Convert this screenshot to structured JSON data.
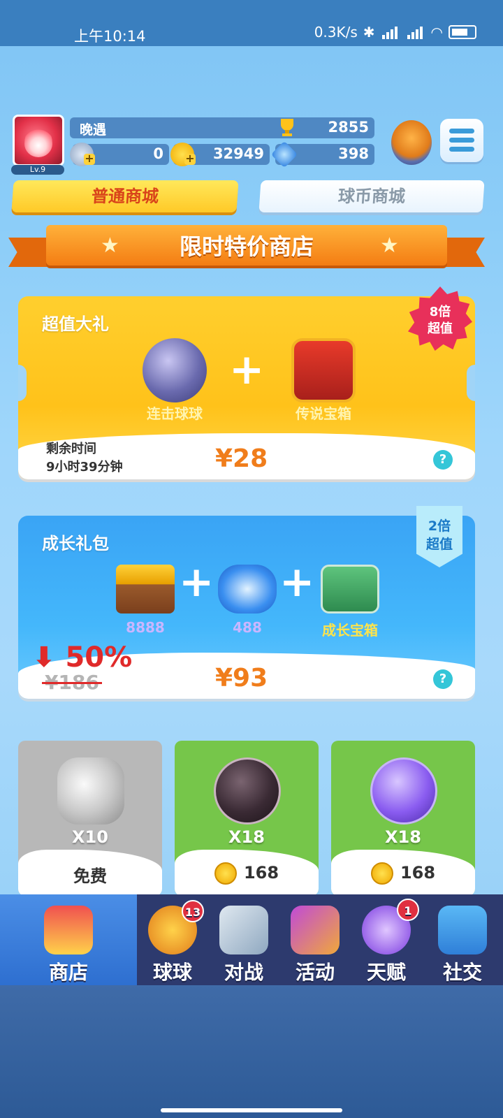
{
  "status": {
    "time": "上午10:14",
    "net": "0.3K/s"
  },
  "player": {
    "name": "晚遇",
    "level": "Lv.9",
    "trophies": "2855",
    "stars": "0",
    "coins": "32949",
    "diamonds": "398"
  },
  "tabs": {
    "normal": "普通商城",
    "ballcoin": "球币商城"
  },
  "banner": {
    "title": "限时特价商店"
  },
  "deal1": {
    "title": "超值大礼",
    "item1": "连击球球",
    "item2": "传说宝箱",
    "remain_label": "剩余时间",
    "remain_time": "9小时39分钟",
    "price": "¥28",
    "badge_top": "8倍",
    "badge_bottom": "超值",
    "help": "?"
  },
  "deal2": {
    "title": "成长礼包",
    "item1": "8888",
    "item2": "488",
    "item3": "成长宝箱",
    "discount": "50%",
    "old_price": "¥186",
    "price": "¥93",
    "badge_top": "2倍",
    "badge_bottom": "超值",
    "help": "?"
  },
  "tiles": [
    {
      "qty": "X10",
      "cost": "免费",
      "color": "#b8b8b8"
    },
    {
      "qty": "X18",
      "cost": "168",
      "color": "#76c64a"
    },
    {
      "qty": "X18",
      "cost": "168",
      "color": "#76c64a"
    }
  ],
  "nav": [
    {
      "label": "商店"
    },
    {
      "label": "球球",
      "badge": "13"
    },
    {
      "label": "对战"
    },
    {
      "label": "活动"
    },
    {
      "label": "天赋",
      "badge": "1"
    },
    {
      "label": "社交"
    }
  ],
  "colors": {
    "accent_yellow": "#ffc21a",
    "accent_blue": "#3aa4f5",
    "nav_bg": "#2d3a6e",
    "price_orange": "#f07d1b"
  }
}
